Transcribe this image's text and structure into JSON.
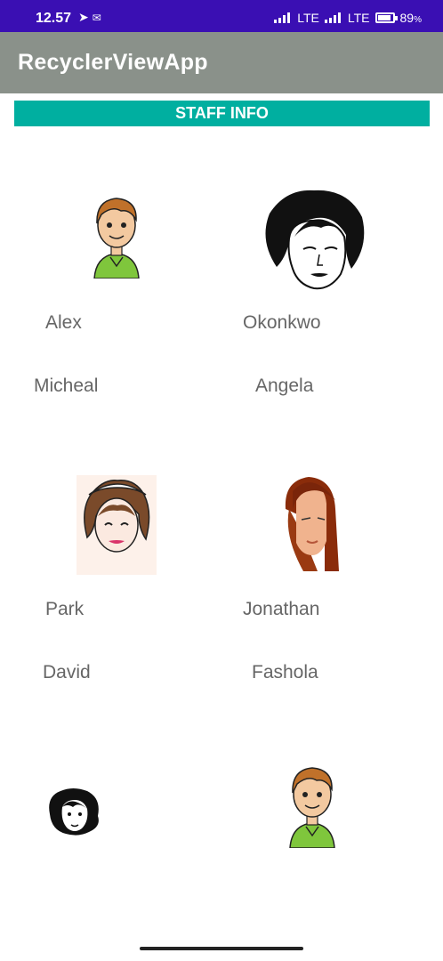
{
  "status_bar": {
    "time": "12.57",
    "network_1": "LTE",
    "network_2": "LTE",
    "battery": "89",
    "battery_unit": "%"
  },
  "app_bar": {
    "title": "RecyclerViewApp"
  },
  "banner": {
    "label": "STAFF INFO"
  },
  "staff": [
    {
      "first_name": "Alex",
      "last_name": "Micheal",
      "avatar": "boy-green-shirt-avatar"
    },
    {
      "first_name": "Okonkwo",
      "last_name": "Angela",
      "avatar": "curly-hair-woman-avatar"
    },
    {
      "first_name": "Park",
      "last_name": "David",
      "avatar": "brown-hair-woman-avatar"
    },
    {
      "first_name": "Jonathan",
      "last_name": "Fashola",
      "avatar": "red-hair-woman-avatar"
    },
    {
      "first_name": "",
      "last_name": "",
      "avatar": "black-hair-woman-avatar"
    },
    {
      "first_name": "",
      "last_name": "",
      "avatar": "boy-green-shirt-avatar"
    }
  ]
}
